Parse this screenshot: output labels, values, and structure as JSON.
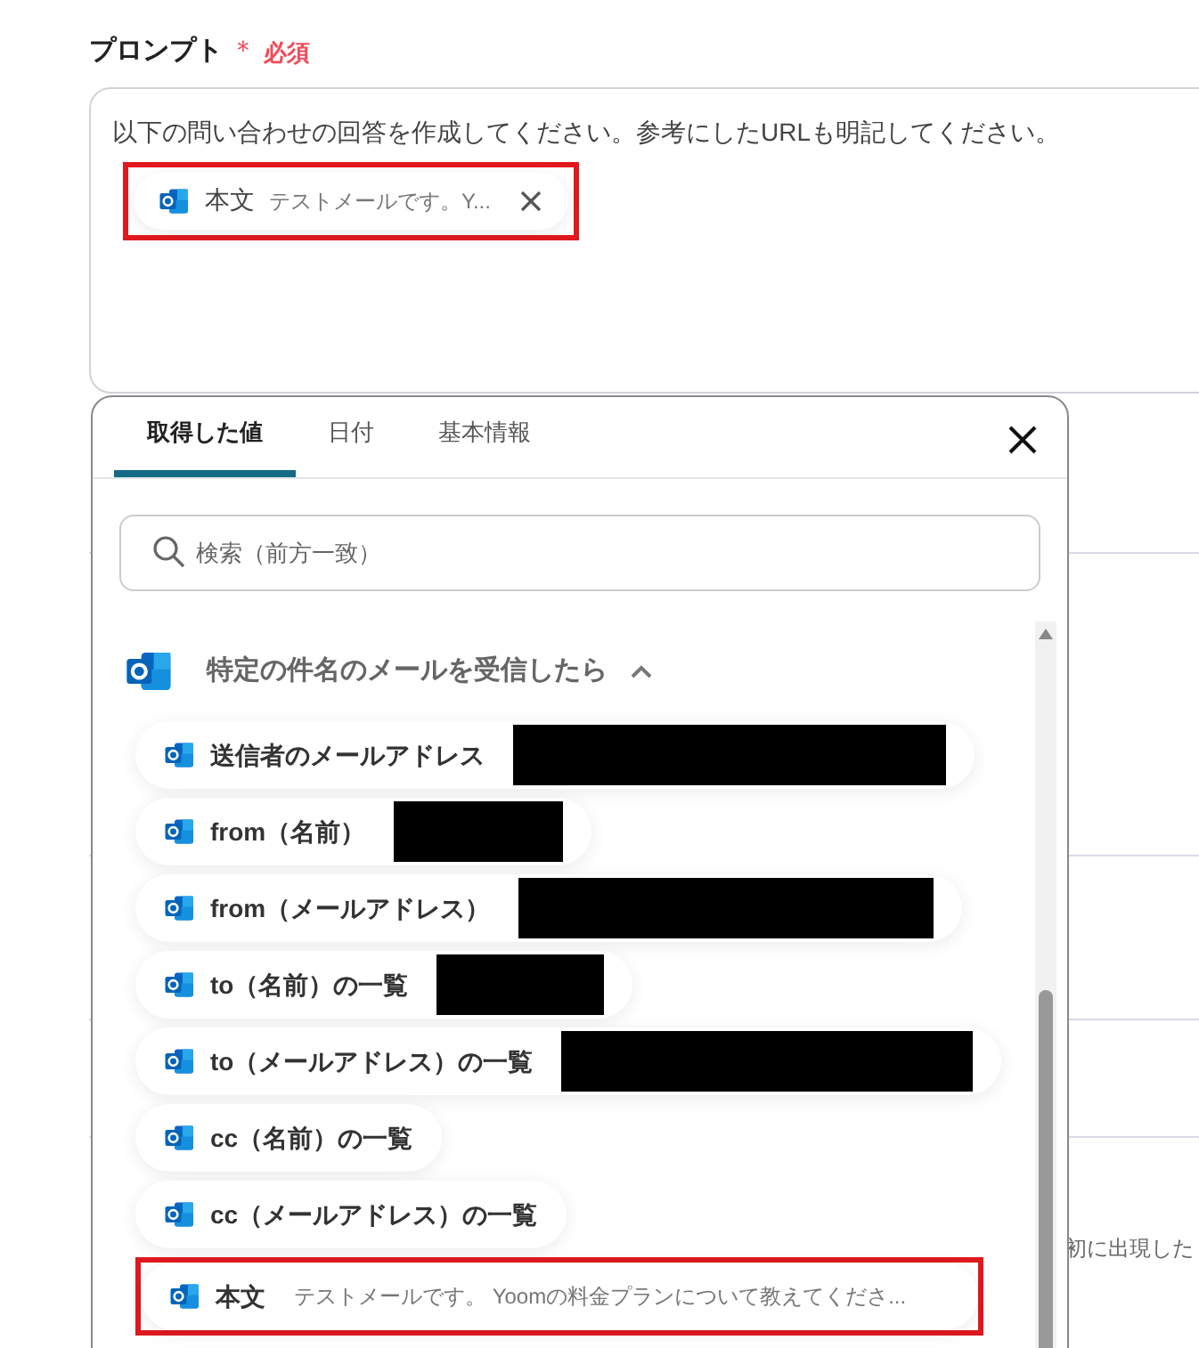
{
  "field": {
    "label": "プロンプト",
    "required_mark": "＊",
    "required_text": "必須",
    "text": "以下の問い合わせの回答を作成してください。参考にしたURLも明記してください。",
    "chip": {
      "label": "本文",
      "value": "テストメールです。Y...",
      "highlighted": true
    }
  },
  "background_text": "初に出現した",
  "popup": {
    "tabs": [
      {
        "label": "取得した値",
        "selected": true
      },
      {
        "label": "日付",
        "selected": false
      },
      {
        "label": "基本情報",
        "selected": false
      }
    ],
    "search": {
      "placeholder": "検索（前方一致）"
    },
    "group": {
      "title": "特定の件名のメールを受信したら",
      "expanded": true,
      "items": [
        {
          "label": "送信者のメールアドレス",
          "redacted": true,
          "highlighted": false
        },
        {
          "label": "from（名前）",
          "redacted": true,
          "highlighted": false
        },
        {
          "label": "from（メールアドレス）",
          "redacted": true,
          "highlighted": false
        },
        {
          "label": "to（名前）の一覧",
          "redacted": true,
          "highlighted": false
        },
        {
          "label": "to（メールアドレス）の一覧",
          "redacted": true,
          "highlighted": false
        },
        {
          "label": "cc（名前）の一覧",
          "redacted": false,
          "highlighted": false
        },
        {
          "label": "cc（メールアドレス）の一覧",
          "redacted": false,
          "highlighted": false
        },
        {
          "label": "本文",
          "value": "テストメールです。 Yoomの料金プランについて教えてくださ...",
          "redacted": false,
          "highlighted": true
        }
      ]
    }
  }
}
